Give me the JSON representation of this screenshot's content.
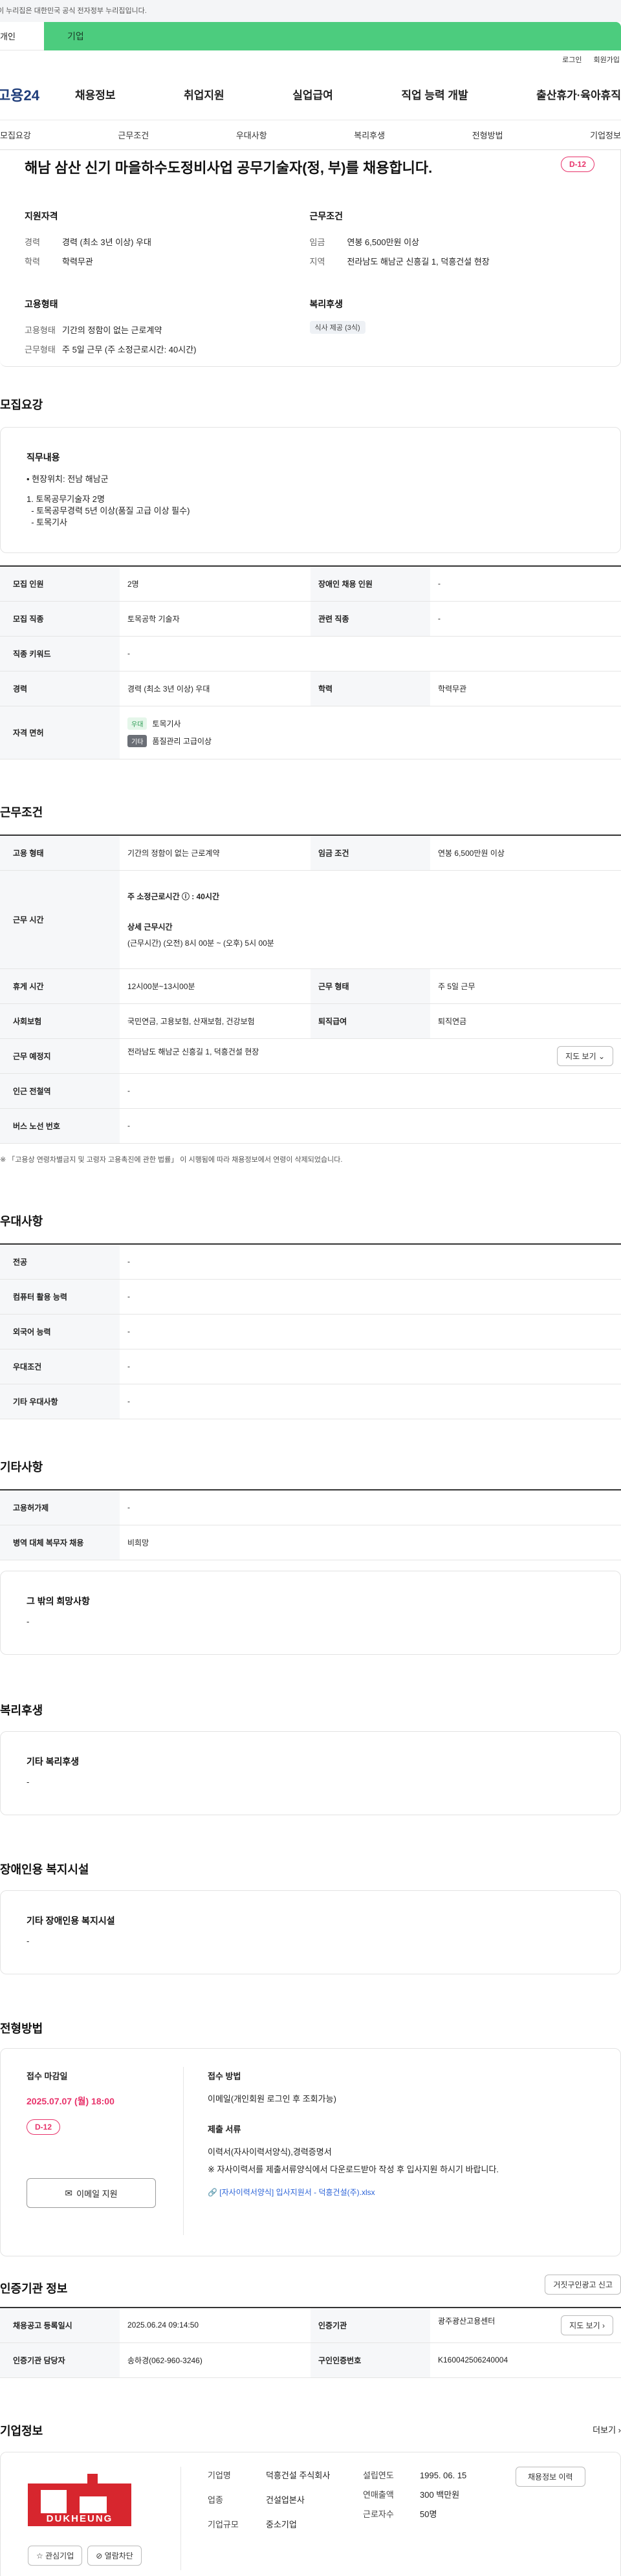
{
  "gov_bar": "이 누리집은 대한민국 공식 전자정부 누리집입니다.",
  "tabs": {
    "personal": "개인",
    "corp": "기업"
  },
  "util": {
    "login": "로그인",
    "join": "회원가입"
  },
  "logo": "고용24",
  "gnb": [
    "채용정보",
    "취업지원",
    "실업급여",
    "직업 능력 개발",
    "출산휴가·육아휴직"
  ],
  "sec_nav": [
    "모집요강",
    "근무조건",
    "우대사항",
    "복리후생",
    "전형방법",
    "기업정보"
  ],
  "summary": {
    "title": "해남 삼산 신기 마을하수도정비사업 공무기술자(정, 부)를 채용합니다.",
    "dday": "D-12",
    "qual": {
      "heading": "지원자격",
      "career_k": "경력",
      "career_v": "경력 (최소 3년 이상) 우대",
      "edu_k": "학력",
      "edu_v": "학력무관"
    },
    "cond": {
      "heading": "근무조건",
      "wage_k": "임금",
      "wage_v": "연봉 6,500만원 이상",
      "region_k": "지역",
      "region_v": "전라남도 해남군 신흥길 1, 덕흥건설 현장"
    },
    "employ": {
      "heading": "고용형태",
      "type_k": "고용형태",
      "type_v": "기간의 정함이 없는 근로계약",
      "work_k": "근무형태",
      "work_v": "주 5일 근무 (주 소정근로시간: 40시간)"
    },
    "welfare": {
      "heading": "복리후생",
      "chip": "식사 제공 (3식)"
    }
  },
  "recruit": {
    "heading": "모집요강",
    "duty_heading": "직무내용",
    "duty_lines": [
      "• 현장위치: 전남 해남군",
      "",
      "1. 토목공무기술자  2명",
      "  - 토목공무경력 5년 이상(품질 고급 이상 필수)",
      "  - 토목기사"
    ],
    "rows": {
      "count_k": "모집 인원",
      "count_v": "2명",
      "disabled_k": "장애인 채용 인원",
      "disabled_v": "-",
      "job_k": "모집 직종",
      "job_v": "토목공학 기술자",
      "rel_k": "관련 직종",
      "rel_v": "-",
      "kw_k": "직종 키워드",
      "kw_v": "-",
      "career_k": "경력",
      "career_v": "경력 (최소 3년 이상) 우대",
      "edu_k": "학력",
      "edu_v": "학력무관",
      "lic_k": "자격 면허",
      "lic1_badge": "우대",
      "lic1": "토목기사",
      "lic2_badge": "기타",
      "lic2": "품질관리 고급이상"
    }
  },
  "work": {
    "heading": "근무조건",
    "type_k": "고용 형태",
    "type_v": "기간의 정함이 없는 근로계약",
    "wage_k": "임금 조건",
    "wage_v": "연봉 6,500만원 이상",
    "hours_k": "근무 시간",
    "hours_weekly": "주 소정근로시간 ⓘ : 40시간",
    "hours_detail_h": "상세 근무시간",
    "hours_detail": "(근무시간) (오전) 8시 00분 ~ (오후) 5시 00분",
    "break_k": "휴게 시간",
    "break_v": "12시00분~13시00분",
    "form_k": "근무 형태",
    "form_v": "주 5일 근무",
    "ins_k": "사회보험",
    "ins_v": "국민연금, 고용보험, 산재보험, 건강보험",
    "ret_k": "퇴직급여",
    "ret_v": "퇴직연금",
    "place_k": "근무 예정지",
    "place_v": "전라남도 해남군 신흥길 1, 덕흥건설 현장",
    "map_btn": "지도 보기 ⌄",
    "sub_k": "인근 전철역",
    "sub_v": "-",
    "bus_k": "버스 노선 번호",
    "bus_v": "-",
    "note": "※ 「고용상 연령차별금지 및 고령자 고용촉진에 관한 법률」 이 시행됨에 따라 채용정보에서 연령이 삭제되었습니다."
  },
  "pref": {
    "heading": "우대사항",
    "rows": [
      {
        "k": "전공",
        "v": "-"
      },
      {
        "k": "컴퓨터 활용 능력",
        "v": "-"
      },
      {
        "k": "외국어 능력",
        "v": "-"
      },
      {
        "k": "우대조건",
        "v": "-"
      },
      {
        "k": "기타 우대사항",
        "v": "-"
      }
    ]
  },
  "etc": {
    "heading": "기타사항",
    "rows": [
      {
        "k": "고용허가제",
        "v": "-"
      },
      {
        "k": "병역 대체 복무자 채용",
        "v": "비희망"
      }
    ],
    "box_h": "그 밖의 희망사항",
    "box_v": "-"
  },
  "welfare": {
    "heading": "복리후생",
    "box_h": "기타 복리후생",
    "box_v": "-"
  },
  "disabled": {
    "heading": "장애인용 복지시설",
    "box_h": "기타 장애인용 복지시설",
    "box_v": "-"
  },
  "select": {
    "heading": "전형방법",
    "deadline_h": "접수 마감일",
    "deadline_v": "2025.07.07 (월) 18:00",
    "dday": "D-12",
    "email_btn": "이메일 지원",
    "method_h": "접수 방법",
    "method_v": "이메일(개인회원 로그인 후 조회가능)",
    "docs_h": "제출 서류",
    "docs1": "이력서(자사이력서양식),경력증명서",
    "docs2": "※ 자사이력서를 제출서류양식에서 다운로드받아 작성 후 입사지원 하시기 바랍니다.",
    "file": "[자사이력서양식] 입사지원서 - 덕흥건설(주).xlsx"
  },
  "agency": {
    "heading": "인증기관 정보",
    "report_btn": "거짓구인광고 신고",
    "reg_k": "채용공고 등록일시",
    "reg_v": "2025.06.24 09:14:50",
    "org_k": "인증기관",
    "org_v": "광주광산고용센터",
    "map_btn": "지도 보기 ›",
    "mgr_k": "인증기관 담당자",
    "mgr_v": "송하경(062-960-3246)",
    "no_k": "구인인증번호",
    "no_v": "K160042506240004"
  },
  "company": {
    "heading": "기업정보",
    "more": "더보기 ›",
    "logo_text": "DUKHEUNG",
    "fav": "☆ 관심기업",
    "block": "⊘ 열람차단",
    "name_k": "기업명",
    "name_v": "덕흥건설 주식회사",
    "ind_k": "업종",
    "ind_v": "건설업본사",
    "size_k": "기업규모",
    "size_v": "중소기업",
    "est_k": "설립연도",
    "est_v": "1995. 06. 15",
    "sales_k": "연매출액",
    "sales_v": "300 백만원",
    "emp_k": "근로자수",
    "emp_v": "50명",
    "job_btn": "채용정보 이력"
  },
  "colors": {
    "brand_green": "#4ccc7e",
    "accent_red": "#e8336b",
    "link_blue": "#2b63d8"
  }
}
